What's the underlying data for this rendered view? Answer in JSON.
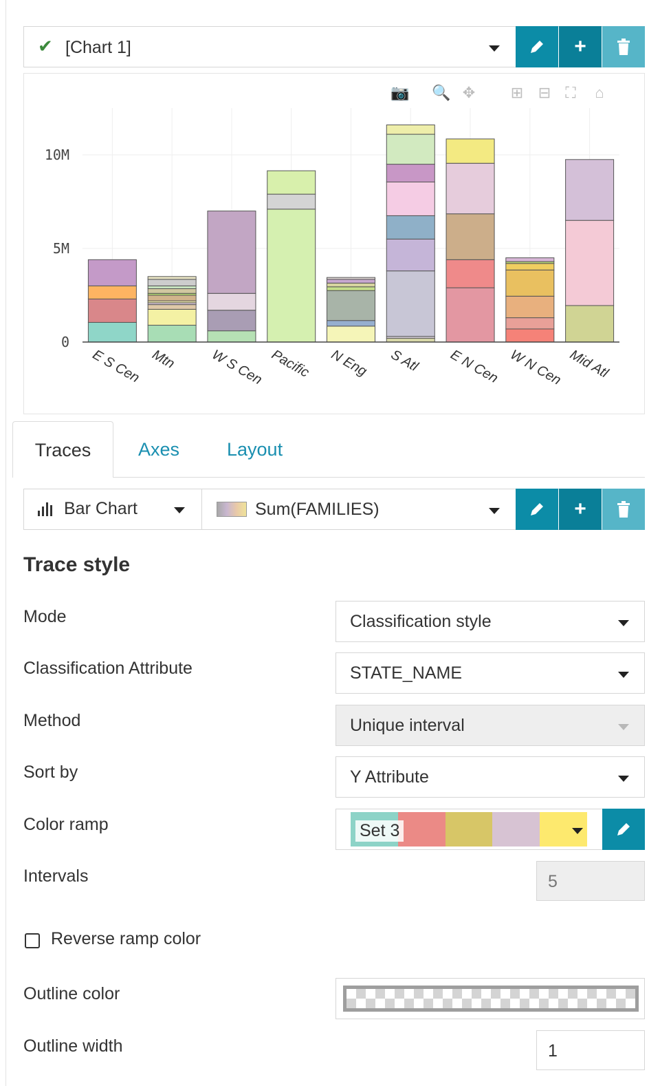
{
  "chart_selector": {
    "label": "[Chart 1]"
  },
  "chart_data": {
    "type": "bar",
    "stacked": true,
    "categories": [
      "E S Cen",
      "Mtn",
      "W S Cen",
      "Pacific",
      "N Eng",
      "S Atl",
      "E N Cen",
      "W N Cen",
      "Mid Atl"
    ],
    "stacks": [
      [
        1.05,
        1.25,
        0.7,
        1.4
      ],
      [
        0.9,
        0.85,
        0.25,
        0.1,
        0.1,
        0.3,
        0.1,
        0.25,
        0.15,
        0.35,
        0.15
      ],
      [
        0.6,
        1.1,
        0.9,
        4.4
      ],
      [
        7.1,
        0.8,
        1.25
      ],
      [
        0.85,
        0.3,
        1.6,
        0.2,
        0.2,
        0.2,
        0.1
      ],
      [
        0.2,
        0.1,
        3.5,
        1.7,
        1.25,
        1.8,
        0.95,
        1.6,
        0.5
      ],
      [
        2.9,
        1.5,
        2.45,
        2.7,
        1.3
      ],
      [
        0.7,
        0.6,
        1.15,
        1.4,
        0.35,
        0.1,
        0.2
      ],
      [
        1.95,
        4.55,
        3.25
      ]
    ],
    "stack_colors": [
      [
        "#8fd6c8",
        "#d9878a",
        "#fdb462",
        "#c49ac8"
      ],
      [
        "#a8ddb5",
        "#f4f1a4",
        "#e0c9a8",
        "#d6c4d6",
        "#f4eeaa",
        "#d2b48c",
        "#b3d670",
        "#d2c8a0",
        "#c7e2bf",
        "#cdcdcd",
        "#e8e4c4"
      ],
      [
        "#b6e1b4",
        "#a99db4",
        "#e4d6e0",
        "#c2a6c4"
      ],
      [
        "#d5f0b0",
        "#d4d4d4",
        "#d8f0ac"
      ],
      [
        "#f5f5b8",
        "#96afcf",
        "#a8b4a8",
        "#c5de8a",
        "#d8d4a0",
        "#c8a8d0",
        "#e2d8d8"
      ],
      [
        "#d8d8a8",
        "#d8d0d8",
        "#c8c6d6",
        "#c5b5d8",
        "#8fb0c8",
        "#f5cce4",
        "#c897c6",
        "#d2eac0",
        "#eeeeaa"
      ],
      [
        "#e397a2",
        "#ef8a8a",
        "#ccae8a",
        "#e6ccdc",
        "#f3ea82"
      ],
      [
        "#f58278",
        "#e8a098",
        "#e8b07e",
        "#e9c060",
        "#f0ce60",
        "#b5d474",
        "#d8b6d8"
      ],
      [
        "#d0d494",
        "#f4cad6",
        "#d4c0d8"
      ]
    ],
    "ylim": [
      0,
      12.5
    ],
    "yticks": [
      0,
      5,
      10
    ],
    "ytick_labels": [
      "0",
      "5M",
      "10M"
    ],
    "grid": true
  },
  "tabs": [
    "Traces",
    "Axes",
    "Layout"
  ],
  "trace_bar": {
    "type_label": "Bar Chart",
    "trace_label": "Sum(FAMILIES)"
  },
  "trace_style": {
    "title": "Trace style",
    "mode_label": "Mode",
    "mode_value": "Classification style",
    "class_attr_label": "Classification Attribute",
    "class_attr_value": "STATE_NAME",
    "method_label": "Method",
    "method_value": "Unique interval",
    "sort_label": "Sort by",
    "sort_value": "Y Attribute",
    "ramp_label": "Color ramp",
    "ramp_value": "Set 3",
    "ramp_colors": [
      "#8dd3c7",
      "#eb8a86",
      "#d7c667",
      "#d7c3d3",
      "#fde96e"
    ],
    "intervals_label": "Intervals",
    "intervals_value": "5",
    "reverse_label": "Reverse ramp color",
    "outline_color_label": "Outline color",
    "outline_width_label": "Outline width",
    "outline_width_value": "1"
  }
}
